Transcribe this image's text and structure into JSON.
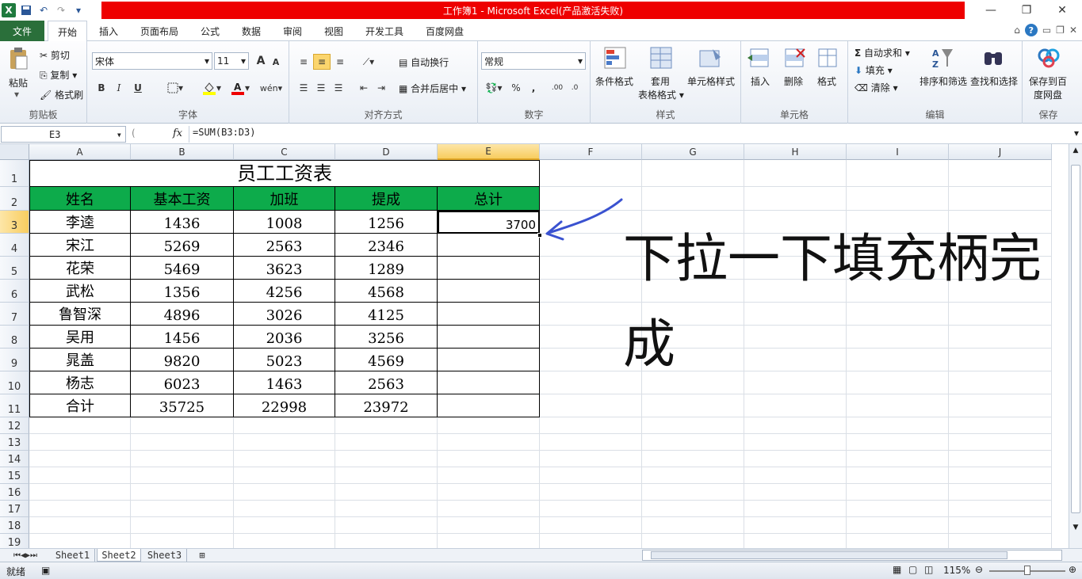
{
  "window": {
    "title": "工作簿1 - Microsoft Excel(产品激活失败)"
  },
  "tabs": [
    "文件",
    "开始",
    "插入",
    "页面布局",
    "公式",
    "数据",
    "审阅",
    "视图",
    "开发工具",
    "百度网盘"
  ],
  "ribbon": {
    "clipboard": {
      "paste": "粘贴",
      "cut": "剪切",
      "copy": "复制",
      "format_painter": "格式刷",
      "label": "剪贴板"
    },
    "font": {
      "name": "宋体",
      "size": "11",
      "label": "字体",
      "bold": "B",
      "italic": "I",
      "underline": "U",
      "grow": "A",
      "shrink": "A"
    },
    "align": {
      "wrap": "自动换行",
      "merge": "合并后居中",
      "label": "对齐方式"
    },
    "number": {
      "format": "常规",
      "label": "数字"
    },
    "styles": {
      "cond": "条件格式",
      "table": "套用",
      "table2": "表格格式",
      "cell": "单元格样式",
      "label": "样式"
    },
    "cells": {
      "insert": "插入",
      "delete": "删除",
      "format": "格式",
      "label": "单元格"
    },
    "edit": {
      "autosum": "自动求和",
      "fill": "填充",
      "clear": "清除",
      "sort": "排序和筛选",
      "find": "查找和选择",
      "label": "编辑"
    },
    "save": {
      "btn1": "保存到百",
      "btn2": "度网盘",
      "label": "保存"
    }
  },
  "formula_bar": {
    "cell_ref": "E3",
    "fx": "fx",
    "formula": "=SUM(B3:D3)"
  },
  "columns": [
    "A",
    "B",
    "C",
    "D",
    "E",
    "F",
    "G",
    "H",
    "I",
    "J"
  ],
  "rows": [
    "1",
    "2",
    "3",
    "4",
    "5",
    "6",
    "7",
    "8",
    "9",
    "10",
    "11",
    "12",
    "13",
    "14",
    "15",
    "16",
    "17",
    "18",
    "19"
  ],
  "sheet": {
    "title": "员工工资表",
    "headers": [
      "姓名",
      "基本工资",
      "加班",
      "提成",
      "总计"
    ],
    "data": [
      [
        "李逵",
        "1436",
        "1008",
        "1256",
        "3700"
      ],
      [
        "宋江",
        "5269",
        "2563",
        "2346",
        ""
      ],
      [
        "花荣",
        "5469",
        "3623",
        "1289",
        ""
      ],
      [
        "武松",
        "1356",
        "4256",
        "4568",
        ""
      ],
      [
        "鲁智深",
        "4896",
        "3026",
        "4125",
        ""
      ],
      [
        "吴用",
        "1456",
        "2036",
        "3256",
        ""
      ],
      [
        "晁盖",
        "9820",
        "5023",
        "4569",
        ""
      ],
      [
        "杨志",
        "6023",
        "1463",
        "2563",
        ""
      ],
      [
        "合计",
        "35725",
        "22998",
        "23972",
        ""
      ]
    ]
  },
  "annotation": {
    "line1": "下拉一下填充柄完",
    "line2": "成"
  },
  "sheet_tabs": [
    "Sheet1",
    "Sheet2",
    "Sheet3"
  ],
  "status": {
    "ready": "就绪",
    "zoom": "115%"
  },
  "colors": {
    "header_green": "#0dab4b",
    "title_red": "#ee0000",
    "arrow_blue": "#3a52d0"
  }
}
